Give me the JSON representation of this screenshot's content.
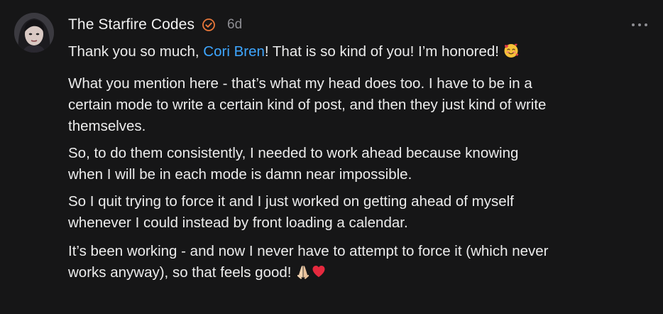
{
  "comment": {
    "author": "The Starfire Codes",
    "verified_icon": "verified-check-icon",
    "timestamp": "6d",
    "more_icon": "ellipsis-icon",
    "paragraphs": {
      "p1_before": "Thank you so much, ",
      "p1_mention": "Cori Bren",
      "p1_after": "! That is so kind of you! I’m honored!",
      "p1_emoji": "smiling-face-with-hearts",
      "p2_line1": "What you mention here - that’s what my head does too. I have to be in a",
      "p2_line2": "certain mode to write a certain kind of post, and then they just kind of write",
      "p2_line3": "themselves.",
      "p3_line1": "So, to do them consistently, I needed to work ahead because knowing",
      "p3_line2": "when I will be in each mode is damn near impossible.",
      "p4_line1": "So I quit trying to force it and I just worked on getting ahead of myself",
      "p4_line2": "whenever I could instead by front loading a calendar.",
      "p5_line1": "It’s been working - and now I never have to attempt to force it (which never",
      "p5_line2": "works anyway), so that feels good!",
      "p5_emojis": [
        "folded-hands",
        "red-heart"
      ]
    },
    "colors": {
      "background": "#161617",
      "text": "#ececec",
      "mention": "#3ea6ff",
      "verified": "#e8773a",
      "muted": "#8e8e93"
    }
  }
}
